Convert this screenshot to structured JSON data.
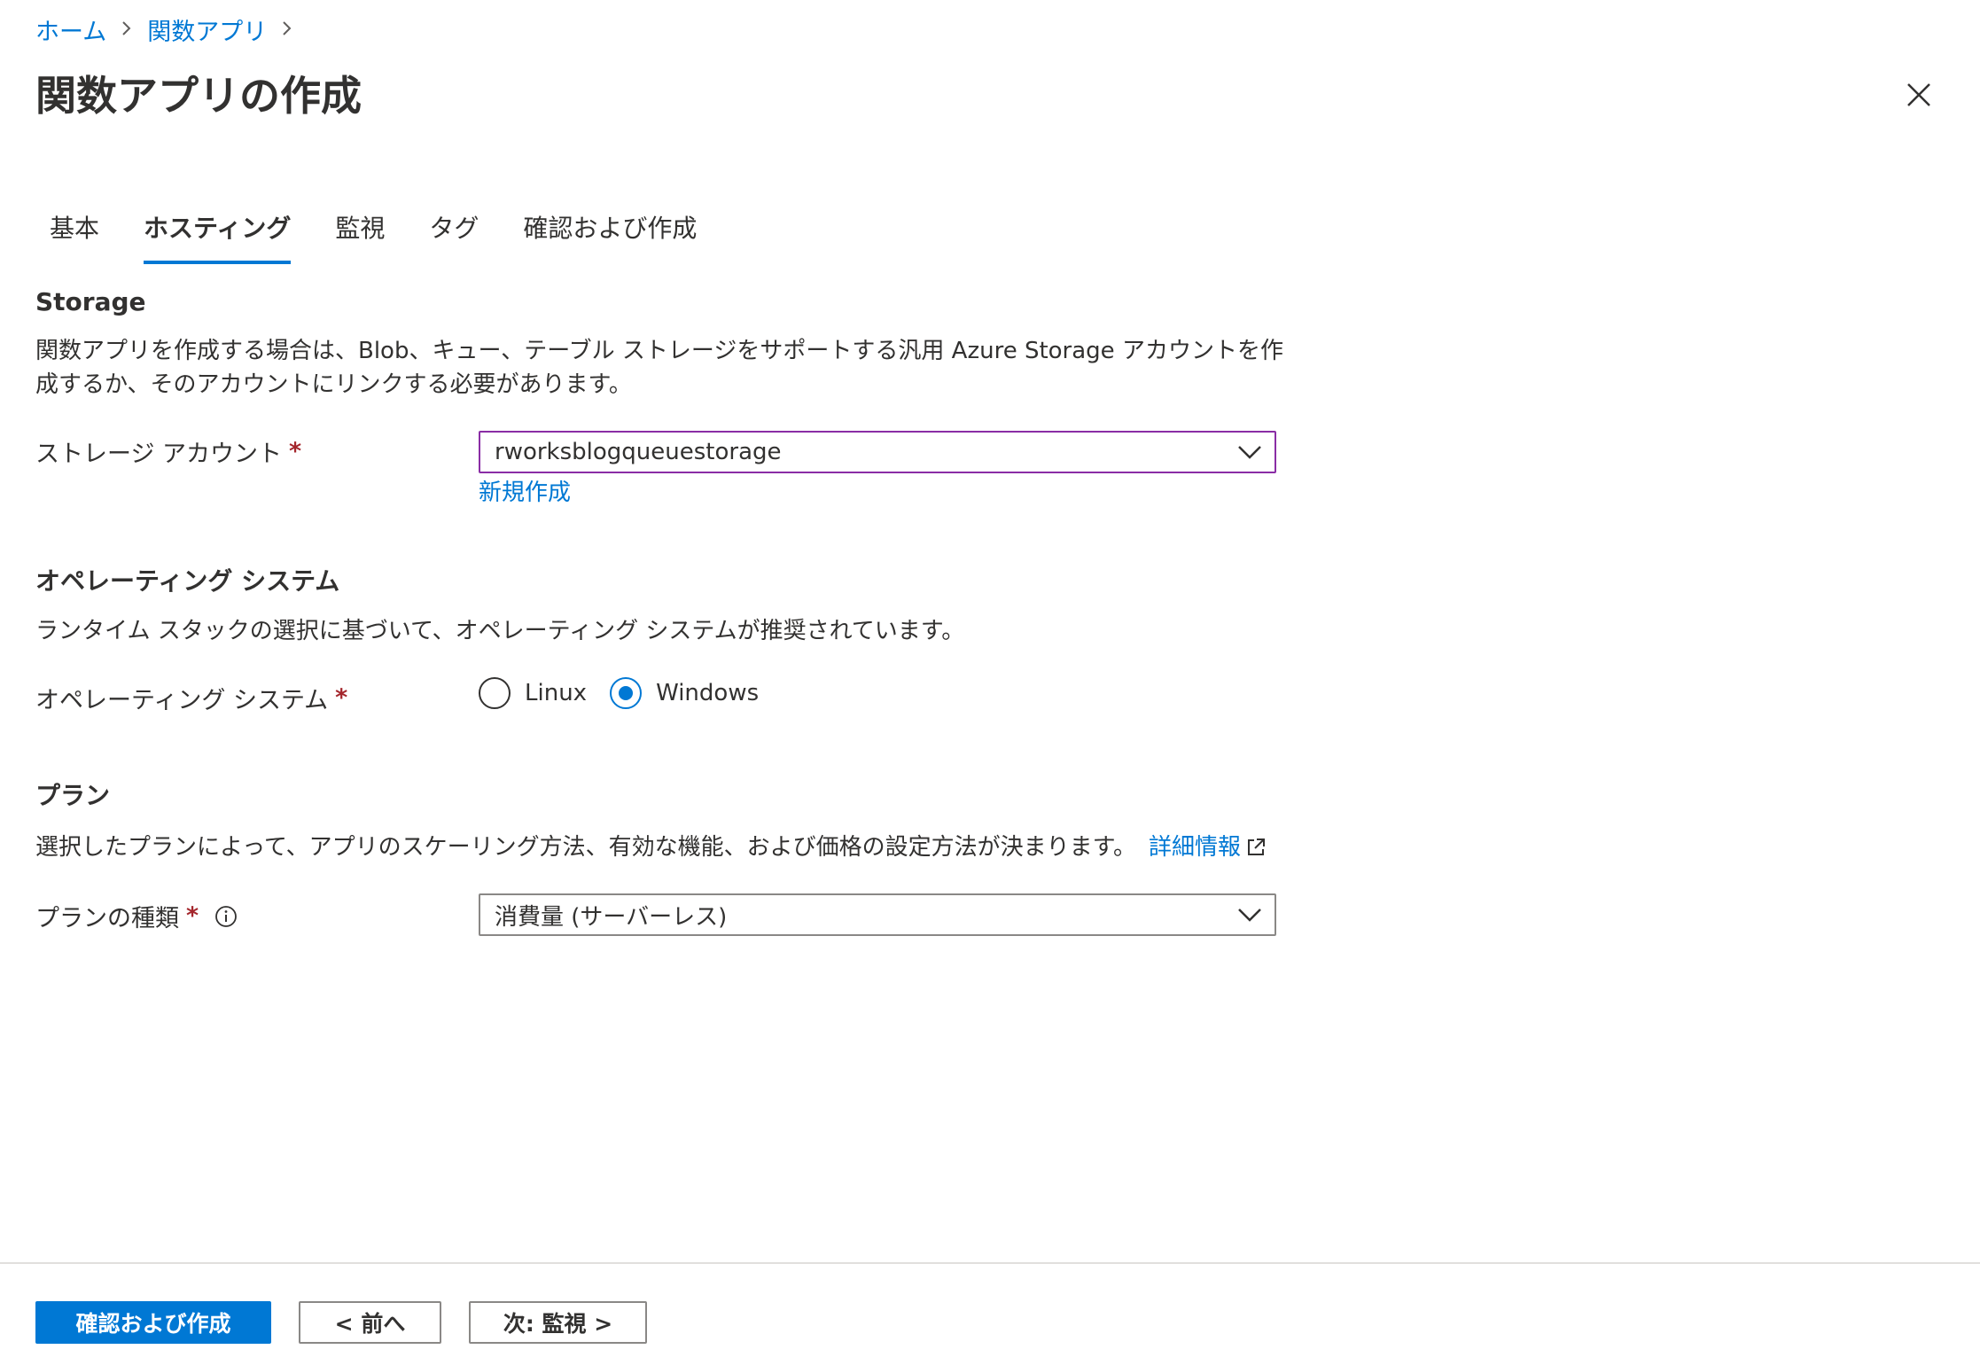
{
  "breadcrumb": [
    {
      "label": "ホーム"
    },
    {
      "label": "関数アプリ"
    }
  ],
  "page": {
    "title": "関数アプリの作成",
    "close_icon": "close-icon"
  },
  "tabs": [
    {
      "label": "基本",
      "active": false
    },
    {
      "label": "ホスティング",
      "active": true
    },
    {
      "label": "監視",
      "active": false
    },
    {
      "label": "タグ",
      "active": false
    },
    {
      "label": "確認および作成",
      "active": false
    }
  ],
  "storage": {
    "title": "Storage",
    "description_line1": "関数アプリを作成する場合は、Blob、キュー、テーブル ストレージをサポートする汎用 Azure Storage アカウントを作",
    "description_line2": "成するか、そのアカウントにリンクする必要があります。",
    "account_label": "ストレージ アカウント",
    "required_mark": "*",
    "account_value": "rworksblogqueuestorage",
    "create_new_link": "新規作成"
  },
  "os": {
    "title": "オペレーティング システム",
    "description": "ランタイム スタックの選択に基づいて、オペレーティング システムが推奨されています。",
    "field_label": "オペレーティング システム",
    "required_mark": "*",
    "options": [
      {
        "label": "Linux",
        "selected": false
      },
      {
        "label": "Windows",
        "selected": true
      }
    ]
  },
  "plan": {
    "title": "プラン",
    "description": "選択したプランによって、アプリのスケーリング方法、有効な機能、および価格の設定方法が決まります。",
    "learn_more_link": "詳細情報",
    "field_label": "プランの種類",
    "required_mark": "*",
    "plan_value": "消費量 (サーバーレス)"
  },
  "footer": {
    "review_create_label": "確認および作成",
    "prev_label": "< 前へ",
    "next_label": "次: 監視 >"
  },
  "colors": {
    "accent": "#0078d4",
    "required": "#a4262c",
    "focus_border": "#8a2da5"
  }
}
